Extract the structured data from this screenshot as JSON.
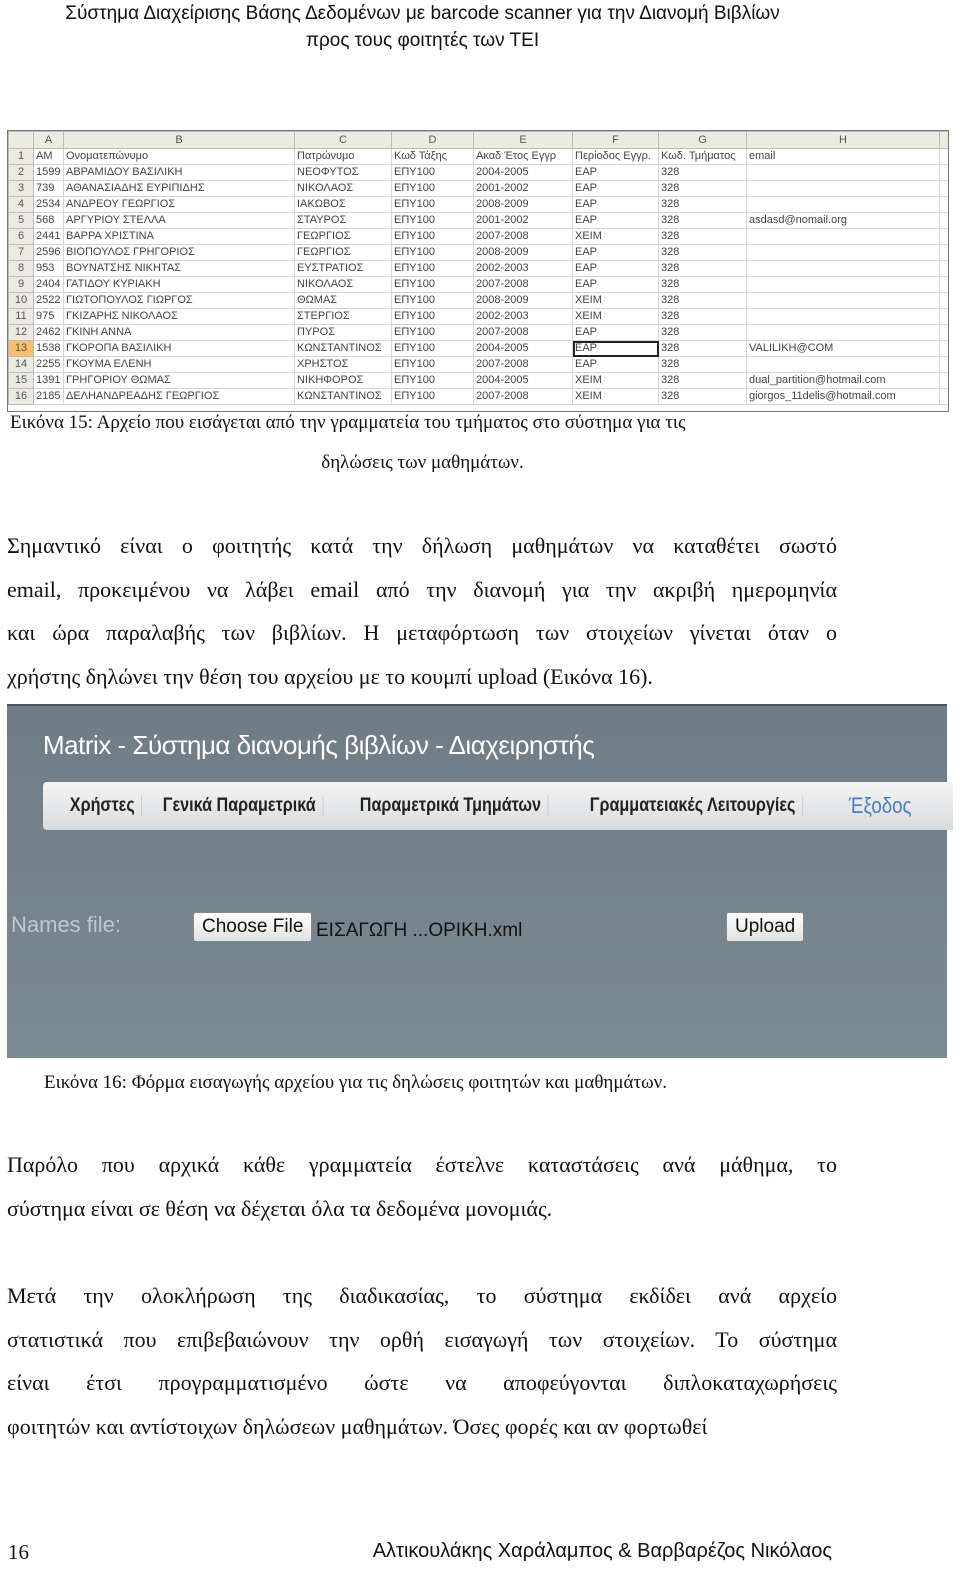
{
  "header": {
    "line1": "Σύστημα Διαχείρισης Βάσης Δεδομένων με barcode scanner για την Διανομή Βιβλίων",
    "line2": "προς τους φοιτητές των ΤΕΙ"
  },
  "spreadsheet": {
    "columns": [
      "",
      "A",
      "B",
      "C",
      "D",
      "E",
      "F",
      "G",
      "H",
      ""
    ],
    "headers": [
      "AM",
      "Ονοματεπώνυμο",
      "Πατρώνυμο",
      "Κωδ Τάξης",
      "Ακαδ Έτος Εγγρ",
      "Περίοδος Εγγρ.",
      "Κωδ. Τμήματος",
      "email"
    ],
    "rows": [
      [
        "1599",
        "ΑΒΡΑΜΙΔΟΥ ΒΑΣΙΛΙΚΗ",
        "ΝΕΟΦΥΤΟΣ",
        "ΕΠΥ100",
        "2004-2005",
        "ΕΑΡ",
        "328",
        ""
      ],
      [
        "739",
        "ΑΘΑΝΑΣΙΑΔΗΣ ΕΥΡΙΠΙΔΗΣ",
        "ΝΙΚΟΛΑΟΣ",
        "ΕΠΥ100",
        "2001-2002",
        "ΕΑΡ",
        "328",
        ""
      ],
      [
        "2534",
        "ΑΝΔΡΕΟΥ ΓΕΩΡΓΙΟΣ",
        "ΙΑΚΩΒΟΣ",
        "ΕΠΥ100",
        "2008-2009",
        "ΕΑΡ",
        "328",
        ""
      ],
      [
        "568",
        "ΑΡΓΥΡΙΟΥ ΣΤΕΛΛΑ",
        "ΣΤΑΥΡΟΣ",
        "ΕΠΥ100",
        "2001-2002",
        "ΕΑΡ",
        "328",
        "asdasd@nomail.org"
      ],
      [
        "2441",
        "ΒΑΡΡΑ ΧΡΙΣΤΙΝΑ",
        "ΓΕΩΡΓΙΟΣ",
        "ΕΠΥ100",
        "2007-2008",
        "ΧΕΙΜ",
        "328",
        ""
      ],
      [
        "2596",
        "ΒΙΟΠΟΥΛΟΣ ΓΡΗΓΟΡΙΟΣ",
        "ΓΕΩΡΓΙΟΣ",
        "ΕΠΥ100",
        "2008-2009",
        "ΕΑΡ",
        "328",
        ""
      ],
      [
        "953",
        "ΒΟΥΝΑΤΣΗΣ ΝΙΚΗΤΑΣ",
        "ΕΥΣΤΡΑΤΙΟΣ",
        "ΕΠΥ100",
        "2002-2003",
        "ΕΑΡ",
        "328",
        ""
      ],
      [
        "2404",
        "ΓΑΤΙΔΟΥ ΚΥΡΙΑΚΗ",
        "ΝΙΚΟΛΑΟΣ",
        "ΕΠΥ100",
        "2007-2008",
        "ΕΑΡ",
        "328",
        ""
      ],
      [
        "2522",
        "ΓΙΩΤΟΠΟΥΛΟΣ ΓΙΩΡΓΟΣ",
        "ΘΩΜΑΣ",
        "ΕΠΥ100",
        "2008-2009",
        "ΧΕΙΜ",
        "328",
        ""
      ],
      [
        "975",
        "ΓΚΙΖΑΡΗΣ ΝΙΚΟΛΑΟΣ",
        "ΣΤΕΡΓΙΟΣ",
        "ΕΠΥ100",
        "2002-2003",
        "ΧΕΙΜ",
        "328",
        ""
      ],
      [
        "2462",
        "ΓΚΙΝΗ ΑΝΝΑ",
        "ΠΥΡΟΣ",
        "ΕΠΥ100",
        "2007-2008",
        "ΕΑΡ",
        "328",
        ""
      ],
      [
        "1538",
        "ΓΚΟΡΟΠΑ ΒΑΣΙΛΙΚΗ",
        "ΚΩΝΣΤΑΝΤΙΝΟΣ",
        "ΕΠΥ100",
        "2004-2005",
        "ΕΑΡ",
        "328",
        "VALILIKH@COM"
      ],
      [
        "2255",
        "ΓΚΟΥΜΑ ΕΛΕΝΗ",
        "ΧΡΗΣΤΟΣ",
        "ΕΠΥ100",
        "2007-2008",
        "ΕΑΡ",
        "328",
        ""
      ],
      [
        "1391",
        "ΓΡΗΓΟΡΙΟΥ ΘΩΜΑΣ",
        "ΝΙΚΗΦΟΡΟΣ",
        "ΕΠΥ100",
        "2004-2005",
        "ΧΕΙΜ",
        "328",
        "dual_partition@hotmail.com"
      ],
      [
        "2185",
        "ΔΕΛΗΑΝΔΡΕΑΔΗΣ ΓΕΩΡΓΙΟΣ",
        "ΚΩΝΣΤΑΝΤΙΝΟΣ",
        "ΕΠΥ100",
        "2007-2008",
        "ΧΕΙΜ",
        "328",
        "giorgos_11delis@hotmail.com"
      ]
    ],
    "selected_row": 13,
    "selected_column": "F"
  },
  "caption15": {
    "line1": "Εικόνα 15: Αρχείο που εισάγεται από την γραμματεία του τμήματος στο σύστημα για τις",
    "line2": "δηλώσεις των μαθημάτων."
  },
  "para1": [
    "Σημαντικό είναι ο φοιτητής κατά την δήλωση μαθημάτων να καταθέτει σωστό",
    "email, προκειμένου να λάβει email από την διανομή για την ακριβή ημερομηνία",
    "και ώρα παραλαβής των βιβλίων. Η μεταφόρτωση των στοιχείων γίνεται όταν ο",
    "χρήστης δηλώνει την θέση του αρχείου με το κουμπί upload (Εικόνα 16)."
  ],
  "app": {
    "title": "Matrix - Σύστημα διανομής βιβλίων - Διαχειρηστής",
    "nav": [
      "Χρήστες",
      "Γενικά Παραμετρικά",
      "Παραμετρικά Τμημάτων",
      "Γραμματειακές Λειτουργίες"
    ],
    "exit": "Έξοδος",
    "names_label": "Names file:",
    "choose_file": "Choose File",
    "file_name": "ΕΙΣΑΓΩΓΗ ...ΟΡΙΚΗ.xml",
    "upload": "Upload"
  },
  "caption16": "Εικόνα 16: Φόρμα εισαγωγής αρχείου για τις δηλώσεις φοιτητών και μαθημάτων.",
  "para2": [
    "Παρόλο που αρχικά κάθε γραμματεία έστελνε καταστάσεις ανά μάθημα, το",
    "σύστημα είναι σε θέση να δέχεται όλα τα δεδομένα μονομιάς."
  ],
  "para3": [
    "Μετά την ολοκλήρωση της διαδικασίας, το σύστημα εκδίδει ανά αρχείο",
    "στατιστικά που επιβεβαιώνουν την ορθή εισαγωγή των στοιχείων. Το σύστημα",
    "είναι έτσι προγραμματισμένο ώστε να αποφεύγονται διπλοκαταχωρήσεις",
    "φοιτητών και αντίστοιχων δηλώσεων μαθημάτων. Όσες φορές και αν φορτωθεί"
  ],
  "footer": {
    "page_number": "16",
    "authors": "Αλτικουλάκης Χαράλαμπος & Βαρβαρέζος Νικόλαος"
  }
}
